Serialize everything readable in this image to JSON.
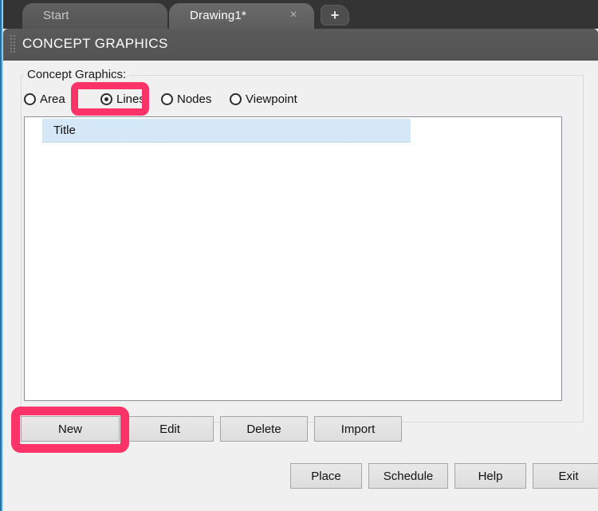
{
  "tabs": {
    "items": [
      {
        "label": "Start",
        "active": false
      },
      {
        "label": "Drawing1*",
        "active": true
      }
    ],
    "close_icon": "×",
    "add_icon": "+"
  },
  "panel": {
    "title": "CONCEPT GRAPHICS"
  },
  "group": {
    "label": "Concept Graphics:"
  },
  "radios": {
    "options": [
      {
        "label": "Area",
        "selected": false
      },
      {
        "label": "Lines",
        "selected": true
      },
      {
        "label": "Nodes",
        "selected": false
      },
      {
        "label": "Viewpoint",
        "selected": false
      }
    ],
    "selected_value": "Lines"
  },
  "list": {
    "columns": [
      "Title"
    ],
    "rows": []
  },
  "action_buttons": [
    {
      "label": "New"
    },
    {
      "label": "Edit"
    },
    {
      "label": "Delete"
    },
    {
      "label": "Import"
    }
  ],
  "footer_buttons": [
    {
      "label": "Place"
    },
    {
      "label": "Schedule"
    },
    {
      "label": "Help"
    },
    {
      "label": "Exit"
    }
  ],
  "highlights": {
    "color": "#fb3368",
    "targets": [
      "Lines",
      "New"
    ]
  },
  "colors": {
    "tab_strip_bg": "#343434",
    "panel_title_bg": "#555555",
    "dialog_bg": "#f0f0f0",
    "list_header_bg": "#d4e8f7",
    "accent_edge": "#2a86c0",
    "highlight_pink": "#fb3368"
  }
}
